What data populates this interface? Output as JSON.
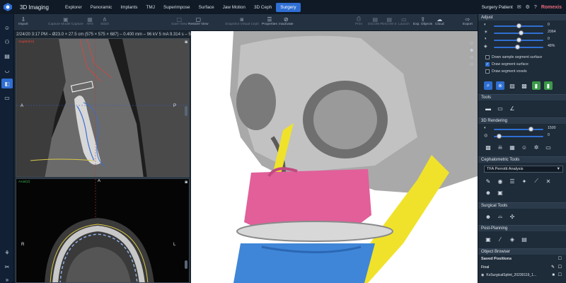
{
  "app": {
    "title": "3D Imaging",
    "brand": "Romexis",
    "patient": "Surgery Patient",
    "brand_color": "#e86a7b",
    "accent": "#2f6fd3"
  },
  "tabs": [
    {
      "label": "Explorer"
    },
    {
      "label": "Panoramic"
    },
    {
      "label": "Implants"
    },
    {
      "label": "TMJ"
    },
    {
      "label": "Superimpose"
    },
    {
      "label": "Surface"
    },
    {
      "label": "Jaw Motion"
    },
    {
      "label": "3D Ceph"
    },
    {
      "label": "Surgery",
      "active": true
    }
  ],
  "top_icons": [
    "help-icon",
    "settings-icon",
    "info-icon"
  ],
  "toolbar": {
    "import": "Import",
    "capture_model": "Capture Model Capture",
    "arx": "ARX",
    "stitch": "Stitch",
    "save_view": "Save View",
    "restore_view": "Restore View",
    "snapshot": "Snapshot Virtual Ceph",
    "properties": "Properties",
    "inactivate": "Inactivate",
    "print": "Print",
    "dicom_p": "DICOM P",
    "dicom_s": "DICOM S",
    "launch": "Launch",
    "exp_objects": "Exp. Objects",
    "cloud": "Cloud",
    "export": "Export"
  },
  "statusline": "2/24/20 3:17 PM – Ø23.0 × 27.5 cm (575 × 575 × 687) – 0.400 mm – 96 kV 5 mA 9.314 s – 50506 pre op",
  "sagittal": {
    "label": "Sagittal(X)",
    "label_color": "#e0433b",
    "orient_left": "A",
    "orient_right": "P"
  },
  "axial": {
    "label": "Axial(Z)",
    "label_color": "#3aa84a",
    "orient_top": "A",
    "orient_left": "R",
    "orient_right": "L"
  },
  "panel": {
    "adjust": {
      "title": "Adjust",
      "sliders": [
        {
          "icon": "contrast-icon",
          "value": "0",
          "level": 0.5
        },
        {
          "icon": "brightness-icon",
          "value": "2064",
          "level": 0.55
        },
        {
          "icon": "gamma-icon",
          "value": "0",
          "level": 0.5
        },
        {
          "icon": "sharpness-icon",
          "value": "48%",
          "level": 0.48
        }
      ],
      "checkboxes": [
        {
          "label": "Down sample segment surface",
          "checked": false
        },
        {
          "label": "Draw segment surface",
          "checked": true
        },
        {
          "label": "Draw segment voxels",
          "checked": false
        }
      ]
    },
    "tools_title": "Tools",
    "rendering": {
      "title": "3D Rendering",
      "slider_value_1": "1500",
      "slider_level_1": 0.75,
      "slider_value_2": "0",
      "slider_level_2": 0.1
    },
    "ceph": {
      "title": "Cephalometric Tools",
      "analysis": "TFA Perrotti Analysis"
    },
    "surgical_title": "Surgical Tools",
    "postplanning_title": "Post-Planning",
    "object_browser": {
      "title": "Object Browser",
      "saved_positions": "Saved Positions",
      "final": "Final",
      "item": "KxSurgicalSplint_20230119_1..."
    }
  }
}
